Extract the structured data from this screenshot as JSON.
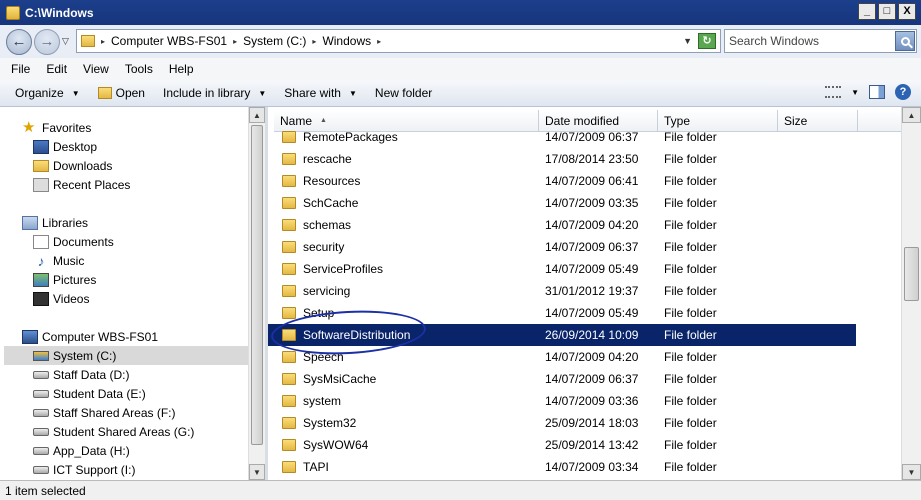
{
  "window": {
    "title": "C:\\Windows",
    "buttons": {
      "minimize": "_",
      "maximize": "□",
      "close": "X"
    }
  },
  "address": {
    "crumbs": [
      "Computer WBS-FS01",
      "System (C:)",
      "Windows"
    ],
    "search_placeholder": "Search Windows"
  },
  "menu": {
    "items": [
      "File",
      "Edit",
      "View",
      "Tools",
      "Help"
    ]
  },
  "toolbar": {
    "organize": "Organize",
    "open": "Open",
    "include_in_library": "Include in library",
    "share_with": "Share with",
    "new_folder": "New folder"
  },
  "nav": {
    "favorites": {
      "label": "Favorites",
      "items": [
        "Desktop",
        "Downloads",
        "Recent Places"
      ]
    },
    "libraries": {
      "label": "Libraries",
      "items": [
        "Documents",
        "Music",
        "Pictures",
        "Videos"
      ]
    },
    "computer": {
      "label": "Computer WBS-FS01",
      "items": [
        "System (C:)",
        "Staff Data (D:)",
        "Student Data (E:)",
        "Staff Shared Areas (F:)",
        "Student Shared Areas (G:)",
        "App_Data (H:)",
        "ICT Support (I:)"
      ]
    },
    "selected": "System (C:)"
  },
  "columns": {
    "name": "Name",
    "date": "Date modified",
    "type": "Type",
    "size": "Size"
  },
  "files": [
    {
      "name": "RemotePackages",
      "date": "14/07/2009 06:37",
      "type": "File folder"
    },
    {
      "name": "rescache",
      "date": "17/08/2014 23:50",
      "type": "File folder"
    },
    {
      "name": "Resources",
      "date": "14/07/2009 06:41",
      "type": "File folder"
    },
    {
      "name": "SchCache",
      "date": "14/07/2009 03:35",
      "type": "File folder"
    },
    {
      "name": "schemas",
      "date": "14/07/2009 04:20",
      "type": "File folder"
    },
    {
      "name": "security",
      "date": "14/07/2009 06:37",
      "type": "File folder"
    },
    {
      "name": "ServiceProfiles",
      "date": "14/07/2009 05:49",
      "type": "File folder"
    },
    {
      "name": "servicing",
      "date": "31/01/2012 19:37",
      "type": "File folder"
    },
    {
      "name": "Setup",
      "date": "14/07/2009 05:49",
      "type": "File folder"
    },
    {
      "name": "SoftwareDistribution",
      "date": "26/09/2014 10:09",
      "type": "File folder",
      "selected": true
    },
    {
      "name": "Speech",
      "date": "14/07/2009 04:20",
      "type": "File folder"
    },
    {
      "name": "SysMsiCache",
      "date": "14/07/2009 06:37",
      "type": "File folder"
    },
    {
      "name": "system",
      "date": "14/07/2009 03:36",
      "type": "File folder"
    },
    {
      "name": "System32",
      "date": "25/09/2014 18:03",
      "type": "File folder"
    },
    {
      "name": "SysWOW64",
      "date": "25/09/2014 13:42",
      "type": "File folder"
    },
    {
      "name": "TAPI",
      "date": "14/07/2009 03:34",
      "type": "File folder"
    }
  ],
  "status": {
    "text": "1 item selected"
  },
  "colors": {
    "selection": "#0a246a",
    "titlebar": "#1c3f8c",
    "annotation": "#1b2fa6"
  }
}
